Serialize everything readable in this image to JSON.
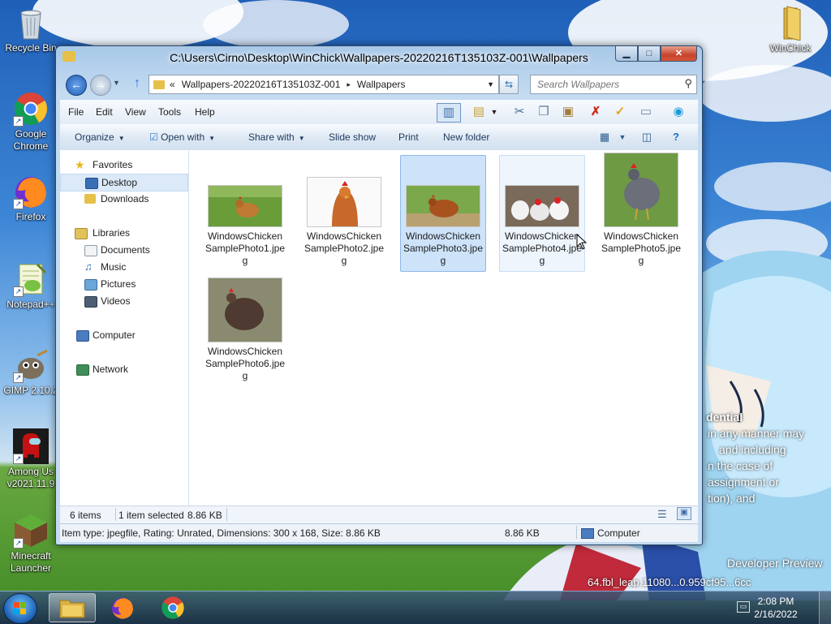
{
  "desktop": {
    "icons": [
      {
        "label": "Recycle Bin"
      },
      {
        "label": "Google Chrome"
      },
      {
        "label": "Firefox"
      },
      {
        "label": "Notepad++"
      },
      {
        "label": "GIMP 2.10.2"
      },
      {
        "label": "Among Us v2021.11.9"
      },
      {
        "label": "Minecraft Launcher"
      },
      {
        "label": "WinChick"
      }
    ],
    "watermark": {
      "lines": [
        "dential",
        "in any manner may",
        "and including",
        "n the case of",
        "assignment or",
        "tion), and"
      ],
      "bottom1": "Developer Preview",
      "bottom2": "64.fbl_leap.11080...0.959cf95...6cc"
    }
  },
  "window": {
    "title": "C:\\Users\\Cirno\\Desktop\\WinChick\\Wallpapers-20220216T135103Z-001\\Wallpapers",
    "controls": {
      "minimize": "▁",
      "maximize": "□",
      "close": "✕"
    },
    "address": {
      "overflow": "«",
      "segments": [
        "Wallpapers-20220216T135103Z-001",
        "Wallpapers"
      ],
      "separator": "▸"
    },
    "search": {
      "placeholder": "Search Wallpapers"
    },
    "menu": [
      "File",
      "Edit",
      "View",
      "Tools",
      "Help"
    ],
    "commands": {
      "organize": "Organize",
      "open_with": "Open with",
      "share_with": "Share with",
      "slide_show": "Slide show",
      "print": "Print",
      "new_folder": "New folder"
    },
    "nav": {
      "favorites": "Favorites",
      "desktop": "Desktop",
      "downloads": "Downloads",
      "libraries": "Libraries",
      "documents": "Documents",
      "music": "Music",
      "pictures": "Pictures",
      "videos": "Videos",
      "computer": "Computer",
      "network": "Network"
    },
    "files": [
      {
        "name": "WindowsChickenSamplePhoto1.jpeg"
      },
      {
        "name": "WindowsChickenSamplePhoto2.jpeg"
      },
      {
        "name": "WindowsChickenSamplePhoto3.jpeg"
      },
      {
        "name": "WindowsChickenSamplePhoto4.jpeg"
      },
      {
        "name": "WindowsChickenSamplePhoto5.jpeg"
      },
      {
        "name": "WindowsChickenSamplePhoto6.jpeg"
      }
    ],
    "status": {
      "count": "6 items",
      "selected": "1 item selected",
      "selected_size": "8.86 KB"
    },
    "info": {
      "details": "Item type: jpegfile, Rating: Unrated, Dimensions: 300 x 168, Size: 8.86 KB",
      "size": "8.86 KB",
      "location": "Computer"
    }
  },
  "taskbar": {
    "time": "2:08 PM",
    "date": "2/16/2022"
  }
}
